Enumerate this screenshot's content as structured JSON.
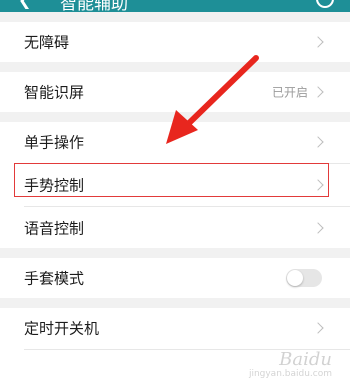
{
  "header": {
    "title": "智能辅助"
  },
  "sections": {
    "accessibility": "无障碍",
    "smart_screen": {
      "label": "智能识屏",
      "value": "已开启"
    },
    "one_hand": "单手操作",
    "gesture": "手势控制",
    "voice": "语音控制",
    "glove": {
      "label": "手套模式",
      "state": "off"
    },
    "scheduled_power": "定时开关机"
  },
  "annotations": {
    "arrow_color": "#e8261e",
    "highlight_color": "#e23a3a"
  },
  "watermark": {
    "brand": "Baidu",
    "sub": "jingyan.baidu.com"
  }
}
